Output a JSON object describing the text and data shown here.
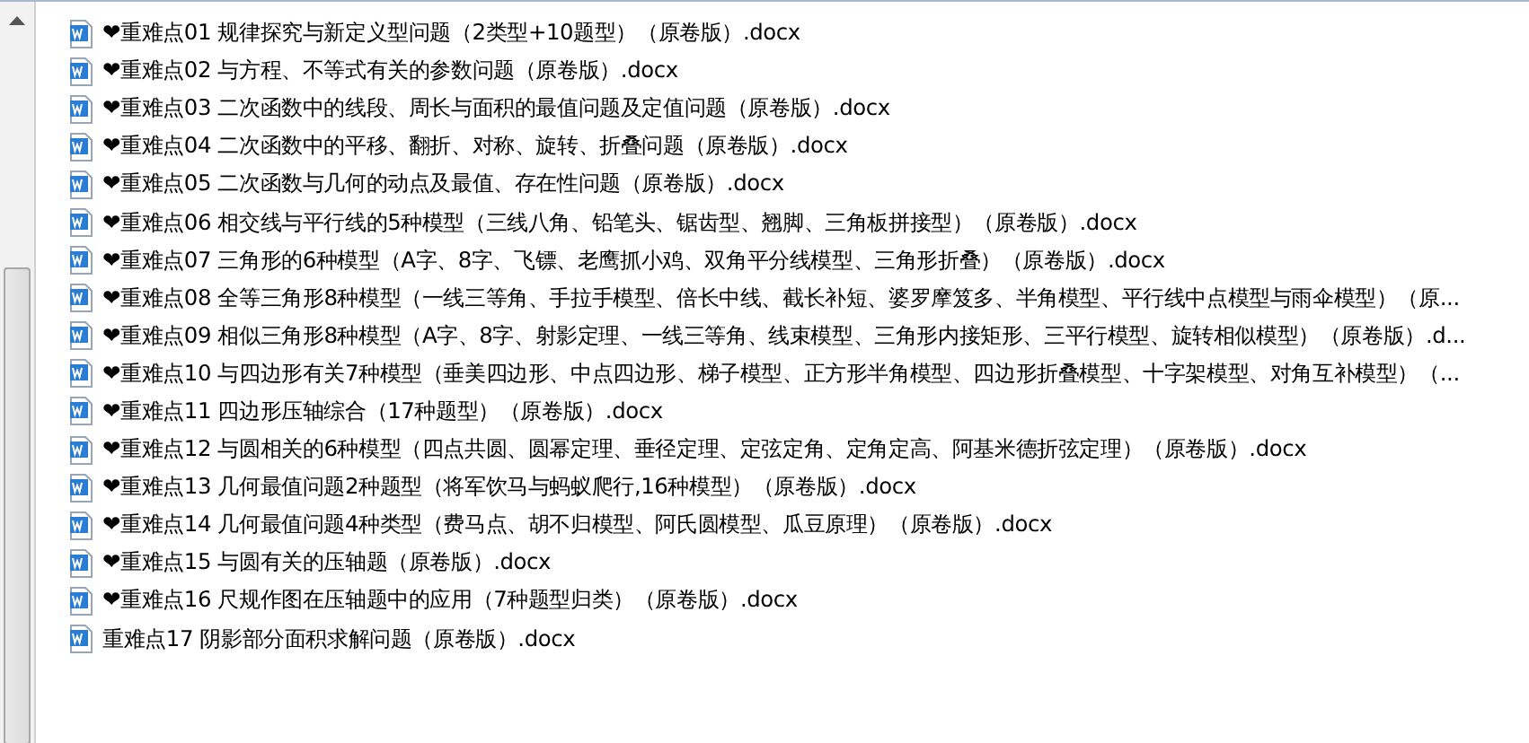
{
  "files": [
    {
      "name": "❤重难点01 规律探究与新定义型问题（2类型+10题型）（原卷版）.docx"
    },
    {
      "name": "❤重难点02 与方程、不等式有关的参数问题（原卷版）.docx"
    },
    {
      "name": "❤重难点03 二次函数中的线段、周长与面积的最值问题及定值问题（原卷版）.docx"
    },
    {
      "name": "❤重难点04 二次函数中的平移、翻折、对称、旋转、折叠问题（原卷版）.docx"
    },
    {
      "name": "❤重难点05 二次函数与几何的动点及最值、存在性问题（原卷版）.docx"
    },
    {
      "name": "❤重难点06 相交线与平行线的5种模型（三线八角、铅笔头、锯齿型、翘脚、三角板拼接型）（原卷版）.docx"
    },
    {
      "name": "❤重难点07  三角形的6种模型（A字、8字、飞镖、老鹰抓小鸡、双角平分线模型、三角形折叠）（原卷版）.docx"
    },
    {
      "name": "❤重难点08 全等三角形8种模型（一线三等角、手拉手模型、倍长中线、截长补短、婆罗摩笈多、半角模型、平行线中点模型与雨伞模型）（原..."
    },
    {
      "name": "❤重难点09 相似三角形8种模型（A字、8字、射影定理、一线三等角、线束模型、三角形内接矩形、三平行模型、旋转相似模型）（原卷版）.d..."
    },
    {
      "name": "❤重难点10 与四边形有关7种模型（垂美四边形、中点四边形、梯子模型、正方形半角模型、四边形折叠模型、十字架模型、对角互补模型）（..."
    },
    {
      "name": "❤重难点11 四边形压轴综合（17种题型）（原卷版）.docx"
    },
    {
      "name": "❤重难点12 与圆相关的6种模型（四点共圆、圆幂定理、垂径定理、定弦定角、定角定高、阿基米德折弦定理）（原卷版）.docx"
    },
    {
      "name": "❤重难点13 几何最值问题2种题型（将军饮马与蚂蚁爬行,16种模型）（原卷版）.docx"
    },
    {
      "name": "❤重难点14 几何最值问题4种类型（费马点、胡不归模型、阿氏圆模型、瓜豆原理）（原卷版）.docx"
    },
    {
      "name": "❤重难点15 与圆有关的压轴题（原卷版）.docx"
    },
    {
      "name": "❤重难点16 尺规作图在压轴题中的应用（7种题型归类）（原卷版）.docx"
    },
    {
      "name": "重难点17 阴影部分面积求解问题（原卷版）.docx"
    }
  ]
}
